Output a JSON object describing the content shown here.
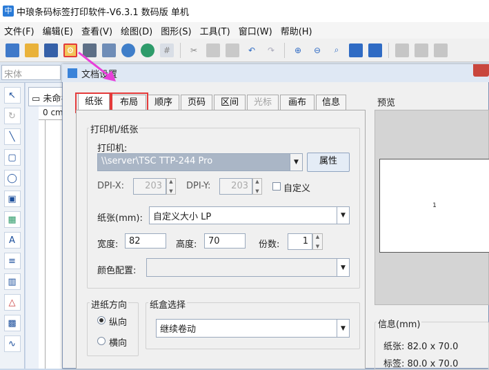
{
  "app": {
    "title": "中琅条码标签打印软件-V6.3.1 数码版 单机"
  },
  "menu": [
    "文件(F)",
    "编辑(E)",
    "查看(V)",
    "绘图(D)",
    "图形(S)",
    "工具(T)",
    "窗口(W)",
    "帮助(H)"
  ],
  "toolbar": {
    "icons": [
      "new-icon",
      "open-icon",
      "save-icon",
      "document-settings-icon",
      "print-icon",
      "print-preview-icon",
      "database-icon",
      "database-settings-icon",
      "grid-icon",
      "cut-icon",
      "copy-icon",
      "paste-icon",
      "undo-icon",
      "redo-icon",
      "zoom-in-icon",
      "zoom-out-icon",
      "zoom-icon",
      "fit-page-icon",
      "fit-width-icon",
      "align-icon"
    ]
  },
  "fontbar": {
    "font_value": "宋体"
  },
  "document": {
    "tab_label": "未命名",
    "ruler_text": "0 cm"
  },
  "dialog": {
    "title": "文档设置",
    "tabs": [
      {
        "label": "纸张",
        "state": "active"
      },
      {
        "label": "布局",
        "state": "normal"
      },
      {
        "label": "顺序",
        "state": "normal"
      },
      {
        "label": "页码",
        "state": "normal"
      },
      {
        "label": "区间",
        "state": "normal"
      },
      {
        "label": "光标",
        "state": "disabled"
      },
      {
        "label": "画布",
        "state": "normal"
      },
      {
        "label": "信息",
        "state": "normal"
      }
    ],
    "printer_group": {
      "title": "打印机/纸张",
      "printer_label": "打印机:",
      "printer_value": "\\\\server\\TSC TTP-244 Pro",
      "properties_button": "属性",
      "dpi_x_label": "DPI-X:",
      "dpi_x_value": "203",
      "dpi_y_label": "DPI-Y:",
      "dpi_y_value": "203",
      "custom_label": "自定义",
      "paper_label": "纸张(mm):",
      "paper_value": "自定义大小 LP",
      "width_label": "宽度:",
      "width_value": "82",
      "height_label": "高度:",
      "height_value": "70",
      "copies_label": "份数:",
      "copies_value": "1",
      "color_label": "颜色配置:",
      "color_value": ""
    },
    "feed_group": {
      "title": "进纸方向",
      "portrait_label": "纵向",
      "landscape_label": "横向",
      "selected": "纵向"
    },
    "tray_group": {
      "title": "纸盒选择",
      "tray_value": "继续卷动"
    },
    "preview": {
      "title": "预览",
      "page_number": "1"
    },
    "info": {
      "title": "信息(mm)",
      "paper_text": "纸张: 82.0 x 70.0",
      "label_text": "标签: 80.0 x 70.0"
    }
  },
  "colors": {
    "highlight_box": "#e43a3a",
    "arrow": "#e83fd8",
    "dialog_bg": "#f0f0f0",
    "selected_combo": "#aab6c6"
  }
}
